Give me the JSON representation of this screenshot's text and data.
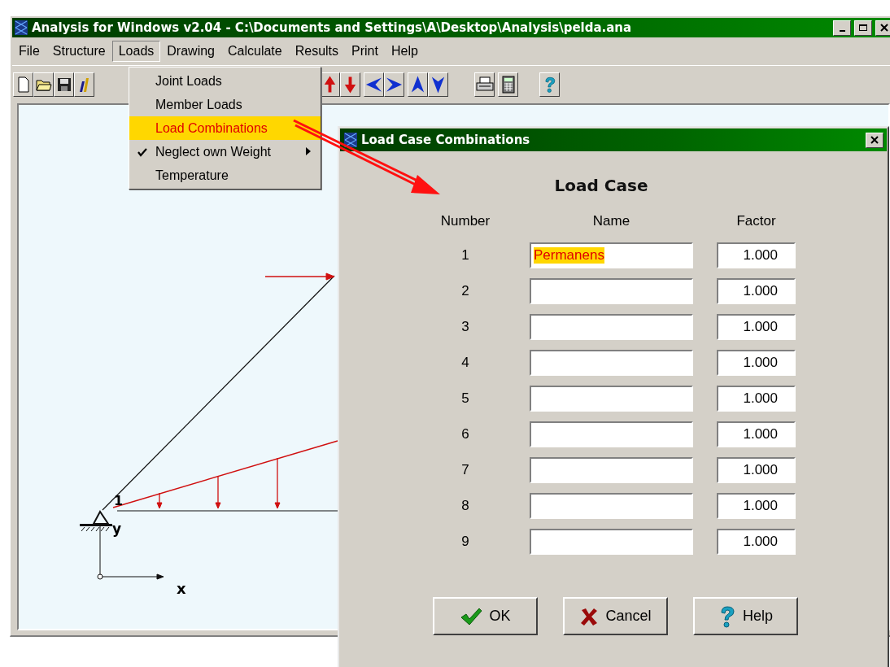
{
  "window": {
    "title": "Analysis for Windows v2.04 - C:\\Documents and Settings\\A\\Desktop\\Analysis\\pelda.ana"
  },
  "menu": [
    {
      "label": "File",
      "selected": false
    },
    {
      "label": "Structure",
      "selected": false
    },
    {
      "label": "Loads",
      "selected": true
    },
    {
      "label": "Drawing",
      "selected": false
    },
    {
      "label": "Calculate",
      "selected": false
    },
    {
      "label": "Results",
      "selected": false
    },
    {
      "label": "Print",
      "selected": false
    },
    {
      "label": "Help",
      "selected": false
    }
  ],
  "dropdown": [
    {
      "label": "Joint Loads",
      "selected": false,
      "checked": false,
      "submenu": false
    },
    {
      "label": "Member Loads",
      "selected": false,
      "checked": false,
      "submenu": false
    },
    {
      "label": "Load Combinations",
      "selected": true,
      "checked": false,
      "submenu": false
    },
    {
      "label": "Neglect own Weight",
      "selected": false,
      "checked": true,
      "submenu": true
    },
    {
      "label": "Temperature",
      "selected": false,
      "checked": false,
      "submenu": false
    }
  ],
  "drawing": {
    "node_label": "1",
    "axis_x": "x",
    "axis_y": "y"
  },
  "dialog": {
    "title": "Load Case Combinations",
    "heading": "Load Case",
    "columns": [
      "Number",
      "Name",
      "Factor"
    ],
    "rows": [
      {
        "number": "1",
        "name": "Permanens",
        "factor": "1.000",
        "highlighted": true
      },
      {
        "number": "2",
        "factor": "1.000"
      },
      {
        "number": "3",
        "factor": "1.000"
      },
      {
        "number": "4",
        "factor": "1.000"
      },
      {
        "number": "5",
        "factor": "1.000"
      },
      {
        "number": "6",
        "factor": "1.000"
      },
      {
        "number": "7",
        "factor": "1.000"
      },
      {
        "number": "8",
        "factor": "1.000"
      },
      {
        "number": "9",
        "factor": "1.000"
      }
    ],
    "buttons": [
      {
        "kind": "ok",
        "label": "OK"
      },
      {
        "kind": "cancel",
        "label": "Cancel"
      },
      {
        "kind": "help",
        "label": "Help"
      }
    ]
  }
}
